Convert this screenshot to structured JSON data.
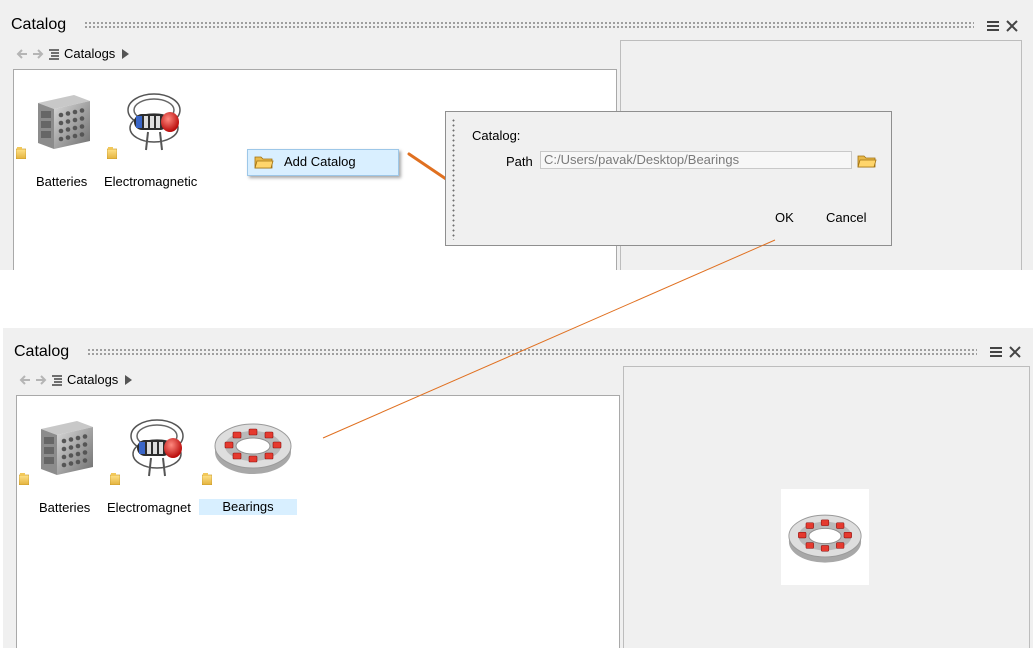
{
  "top": {
    "title": "Catalog",
    "breadcrumb": "Catalogs",
    "items": [
      {
        "label": "Batteries",
        "icon": "batteries-icon"
      },
      {
        "label": "Electromagnetic",
        "icon": "electromagnetic-icon"
      }
    ],
    "context_menu": {
      "label": "Add Catalog",
      "icon": "open-folder-icon"
    },
    "dialog": {
      "heading": "Catalog:",
      "path_label": "Path",
      "path_value": "C:/Users/pavak/Desktop/Bearings",
      "ok_label": "OK",
      "cancel_label": "Cancel"
    }
  },
  "bottom": {
    "title": "Catalog",
    "breadcrumb": "Catalogs",
    "items": [
      {
        "label": "Batteries",
        "icon": "batteries-icon"
      },
      {
        "label": "Electromagnet",
        "icon": "electromagnetic-icon"
      },
      {
        "label": "Bearings",
        "icon": "bearing-icon",
        "selected": true
      }
    ],
    "preview": {
      "icon": "bearing-icon"
    }
  },
  "colors": {
    "accent_line": "#e07020",
    "selection": "#d8efff",
    "panel_bg": "#f0f0f0"
  }
}
